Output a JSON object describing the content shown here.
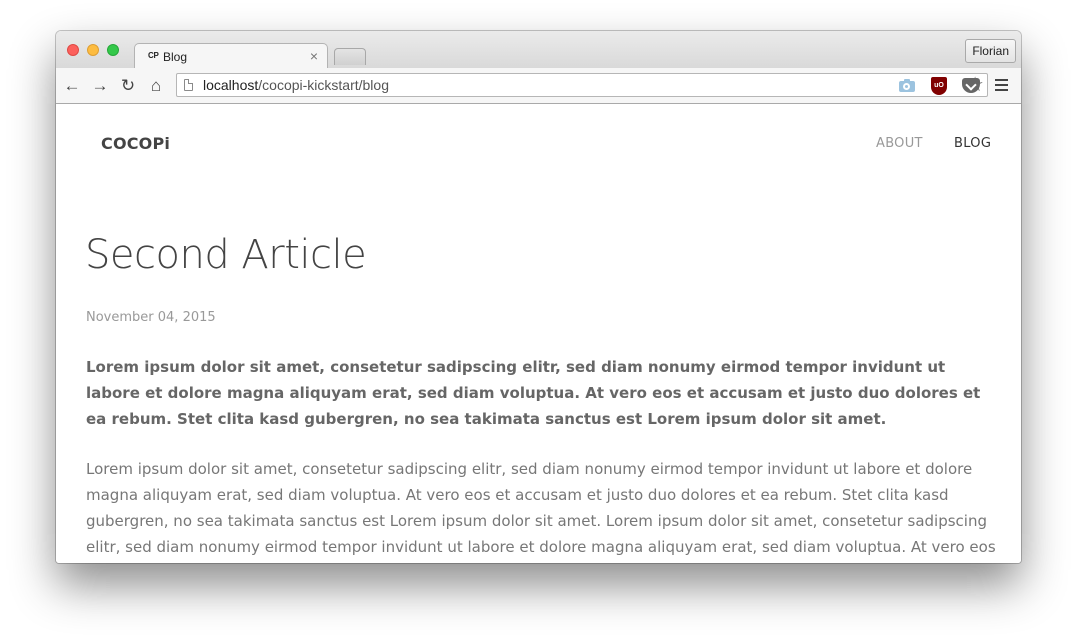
{
  "browser": {
    "tab": {
      "favicon_text": "CP",
      "title": "Blog",
      "close": "×"
    },
    "profile_name": "Florian",
    "url_host": "localhost",
    "url_path": "/cocopi-kickstart/blog",
    "star": "☆",
    "nav": {
      "back": "←",
      "forward": "→",
      "reload": "↻",
      "home": "⌂"
    },
    "extensions": {
      "ublock_label": "uO"
    }
  },
  "site": {
    "brand": "COCOPi",
    "nav": {
      "about": "ABOUT",
      "blog": "BLOG"
    }
  },
  "article": {
    "title": "Second Article",
    "date": "November 04, 2015",
    "lead": "Lorem ipsum dolor sit amet, consetetur sadipscing elitr, sed diam nonumy eirmod tempor invidunt ut labore et dolore magna aliquyam erat, sed diam voluptua. At vero eos et accusam et justo duo dolores et ea rebum. Stet clita kasd gubergren, no sea takimata sanctus est Lorem ipsum dolor sit amet.",
    "body": "Lorem ipsum dolor sit amet, consetetur sadipscing elitr, sed diam nonumy eirmod tempor invidunt ut labore et dolore magna aliquyam erat, sed diam voluptua. At vero eos et accusam et justo duo dolores et ea rebum. Stet clita kasd gubergren, no sea takimata sanctus est Lorem ipsum dolor sit amet. Lorem ipsum dolor sit amet, consetetur sadipscing elitr, sed diam nonumy eirmod tempor invidunt ut labore et dolore magna aliquyam erat, sed diam voluptua. At vero eos"
  },
  "colors": {
    "accent": "#444444",
    "muted": "#999999"
  }
}
